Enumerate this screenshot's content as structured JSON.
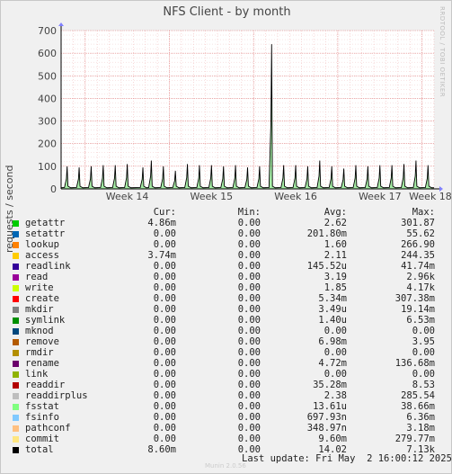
{
  "side_text": "RRDTOOL / TOBI OETIKER",
  "footer": {
    "last_update": "Last update: Fri May  2 16:00:12 2025",
    "brand": "Munin 2.0.56"
  },
  "legend": {
    "headers": {
      "cur": "Cur:",
      "min": "Min:",
      "avg": "Avg:",
      "max": "Max:"
    },
    "rows": [
      {
        "name": "getattr",
        "color": "#00cc00",
        "cur": "4.86m",
        "min": "0.00",
        "avg": "2.62",
        "max": "301.87"
      },
      {
        "name": "setattr",
        "color": "#0066b3",
        "cur": "0.00",
        "min": "0.00",
        "avg": "201.80m",
        "max": "55.62"
      },
      {
        "name": "lookup",
        "color": "#ff8000",
        "cur": "0.00",
        "min": "0.00",
        "avg": "1.60",
        "max": "266.90"
      },
      {
        "name": "access",
        "color": "#ffcc00",
        "cur": "3.74m",
        "min": "0.00",
        "avg": "2.11",
        "max": "244.35"
      },
      {
        "name": "readlink",
        "color": "#330099",
        "cur": "0.00",
        "min": "0.00",
        "avg": "145.52u",
        "max": "41.74m"
      },
      {
        "name": "read",
        "color": "#990099",
        "cur": "0.00",
        "min": "0.00",
        "avg": "3.19",
        "max": "2.96k"
      },
      {
        "name": "write",
        "color": "#ccff00",
        "cur": "0.00",
        "min": "0.00",
        "avg": "1.85",
        "max": "4.17k"
      },
      {
        "name": "create",
        "color": "#ff0000",
        "cur": "0.00",
        "min": "0.00",
        "avg": "5.34m",
        "max": "307.38m"
      },
      {
        "name": "mkdir",
        "color": "#808080",
        "cur": "0.00",
        "min": "0.00",
        "avg": "3.49u",
        "max": "19.14m"
      },
      {
        "name": "symlink",
        "color": "#008f00",
        "cur": "0.00",
        "min": "0.00",
        "avg": "1.40u",
        "max": "6.53m"
      },
      {
        "name": "mknod",
        "color": "#00487d",
        "cur": "0.00",
        "min": "0.00",
        "avg": "0.00",
        "max": "0.00"
      },
      {
        "name": "remove",
        "color": "#b35a00",
        "cur": "0.00",
        "min": "0.00",
        "avg": "6.98m",
        "max": "3.95"
      },
      {
        "name": "rmdir",
        "color": "#b38f00",
        "cur": "0.00",
        "min": "0.00",
        "avg": "0.00",
        "max": "0.00"
      },
      {
        "name": "rename",
        "color": "#6b006b",
        "cur": "0.00",
        "min": "0.00",
        "avg": "4.72m",
        "max": "136.68m"
      },
      {
        "name": "link",
        "color": "#8fb300",
        "cur": "0.00",
        "min": "0.00",
        "avg": "0.00",
        "max": "0.00"
      },
      {
        "name": "readdir",
        "color": "#b30000",
        "cur": "0.00",
        "min": "0.00",
        "avg": "35.28m",
        "max": "8.53"
      },
      {
        "name": "readdirplus",
        "color": "#bebebe",
        "cur": "0.00",
        "min": "0.00",
        "avg": "2.38",
        "max": "285.54"
      },
      {
        "name": "fsstat",
        "color": "#80ff80",
        "cur": "0.00",
        "min": "0.00",
        "avg": "13.61u",
        "max": "38.66m"
      },
      {
        "name": "fsinfo",
        "color": "#80c9ff",
        "cur": "0.00",
        "min": "0.00",
        "avg": "697.93n",
        "max": "6.36m"
      },
      {
        "name": "pathconf",
        "color": "#ffc080",
        "cur": "0.00",
        "min": "0.00",
        "avg": "348.97n",
        "max": "3.18m"
      },
      {
        "name": "commit",
        "color": "#ffe680",
        "cur": "0.00",
        "min": "0.00",
        "avg": "9.60m",
        "max": "279.77m"
      },
      {
        "name": "total",
        "color": "#000000",
        "cur": "8.60m",
        "min": "0.00",
        "avg": "14.02",
        "max": "7.13k"
      }
    ]
  },
  "chart_data": {
    "type": "line",
    "title": "NFS Client - by month",
    "ylabel": "requests / second",
    "xlabel": "",
    "ylim": [
      0,
      700
    ],
    "yticks": [
      0,
      100,
      200,
      300,
      400,
      500,
      600,
      700
    ],
    "grid": true,
    "x_categories": [
      "Week 14",
      "Week 15",
      "Week 16",
      "Week 17",
      "Week 18"
    ],
    "series": [
      {
        "name": "total",
        "color": "#000000",
        "x_days": [
          0.5,
          1.5,
          2.5,
          3.5,
          4.5,
          5.5,
          6.8,
          7.5,
          8.5,
          9.5,
          10.5,
          11.5,
          12.5,
          13.5,
          14.5,
          15.5,
          16.5,
          17.5,
          18.5,
          19.5,
          20.5,
          21.5,
          22.5,
          23.5,
          24.5,
          25.5,
          26.5,
          27.5,
          28.5,
          29.5,
          30.5
        ],
        "peak_values": [
          100,
          95,
          100,
          105,
          105,
          110,
          95,
          125,
          100,
          80,
          110,
          105,
          105,
          100,
          105,
          95,
          100,
          640,
          105,
          105,
          100,
          125,
          100,
          90,
          105,
          100,
          105,
          105,
          110,
          125,
          105
        ]
      }
    ]
  }
}
